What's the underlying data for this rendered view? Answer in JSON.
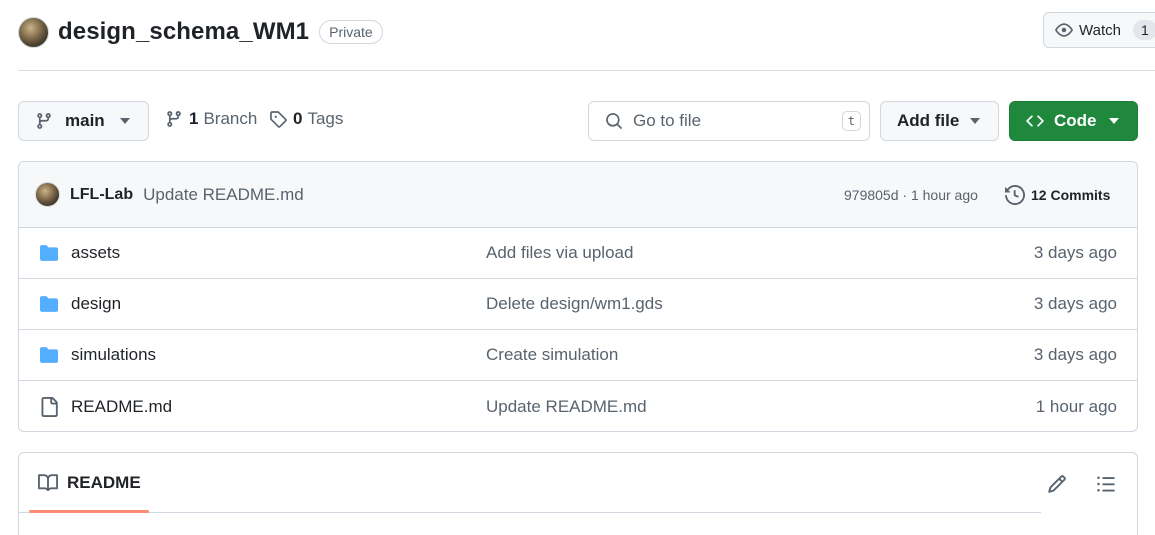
{
  "repo": {
    "name": "design_schema_WM1",
    "visibility": "Private"
  },
  "watch": {
    "label": "Watch",
    "count": "1"
  },
  "toolbar": {
    "branch": "main",
    "branches_count": "1",
    "branches_label": "Branch",
    "tags_count": "0",
    "tags_label": "Tags",
    "search_placeholder": "Go to file",
    "search_shortcut": "t",
    "add_file_label": "Add file",
    "code_label": "Code"
  },
  "latest_commit": {
    "author": "LFL-Lab",
    "message": "Update README.md",
    "hash_time": "979805d · 1 hour ago",
    "commits_label": "12 Commits"
  },
  "files": [
    {
      "type": "folder",
      "name": "assets",
      "message": "Add files via upload",
      "age": "3 days ago"
    },
    {
      "type": "folder",
      "name": "design",
      "message": "Delete design/wm1.gds",
      "age": "3 days ago"
    },
    {
      "type": "folder",
      "name": "simulations",
      "message": "Create simulation",
      "age": "3 days ago"
    },
    {
      "type": "file",
      "name": "README.md",
      "message": "Update README.md",
      "age": "1 hour ago"
    }
  ],
  "readme": {
    "tab_label": "README"
  },
  "colors": {
    "code_button": "#1f883d",
    "folder_icon": "#54aeff",
    "readme_underline": "#fd8c73"
  }
}
